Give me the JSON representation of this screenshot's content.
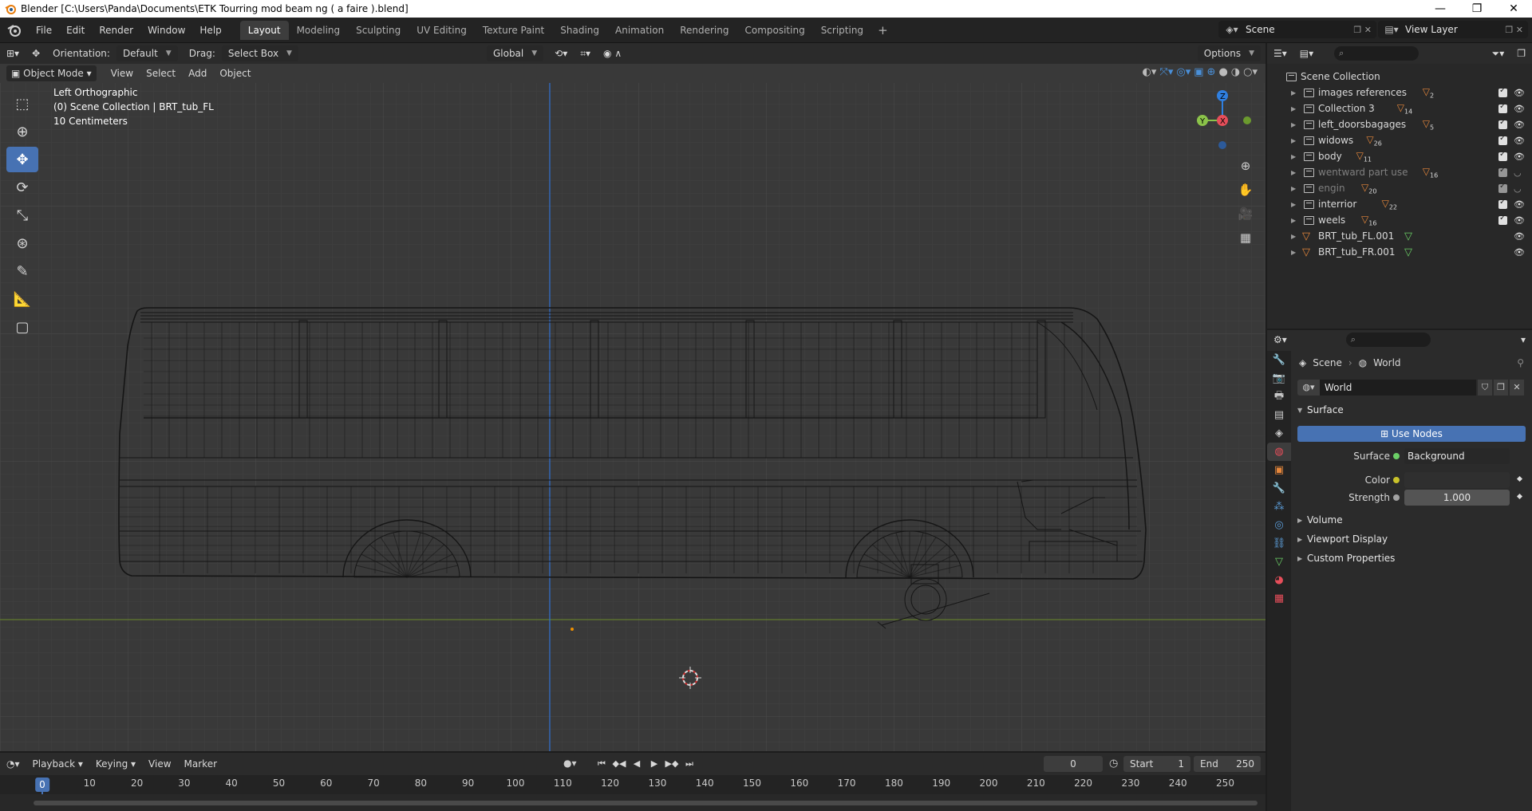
{
  "window": {
    "title": "Blender [C:\\Users\\Panda\\Documents\\ETK Tourring mod beam ng ( a faire ).blend]",
    "controls": [
      "—",
      "❐",
      "✕"
    ]
  },
  "menu": [
    "File",
    "Edit",
    "Render",
    "Window",
    "Help"
  ],
  "workspaces": [
    {
      "label": "Layout",
      "active": true
    },
    {
      "label": "Modeling"
    },
    {
      "label": "Sculpting"
    },
    {
      "label": "UV Editing"
    },
    {
      "label": "Texture Paint"
    },
    {
      "label": "Shading"
    },
    {
      "label": "Animation"
    },
    {
      "label": "Rendering"
    },
    {
      "label": "Compositing"
    },
    {
      "label": "Scripting"
    }
  ],
  "scene_selector": {
    "label": "Scene"
  },
  "view_layer_selector": {
    "label": "View Layer"
  },
  "viewport": {
    "header": {
      "orientation_label": "Orientation:",
      "orientation_value": "Default",
      "drag_label": "Drag:",
      "drag_value": "Select Box",
      "transform_space": "Global",
      "options": "Options"
    },
    "header2": {
      "mode": "Object Mode",
      "menus": [
        "View",
        "Select",
        "Add",
        "Object"
      ]
    },
    "overlay_lines": [
      "Left Orthographic",
      "(0) Scene Collection | BRT_tub_FL",
      "10 Centimeters"
    ],
    "gizmo_axes": {
      "z": "Z",
      "y": "Y",
      "x": "X"
    }
  },
  "timeline": {
    "menus": [
      "Playback",
      "Keying",
      "View",
      "Marker"
    ],
    "current_frame": "0",
    "start_label": "Start",
    "start_value": "1",
    "end_label": "End",
    "end_value": "250",
    "ticks": [
      "0",
      "10",
      "20",
      "30",
      "40",
      "50",
      "60",
      "70",
      "80",
      "90",
      "100",
      "110",
      "120",
      "130",
      "140",
      "150",
      "160",
      "170",
      "180",
      "190",
      "200",
      "210",
      "220",
      "230",
      "240",
      "250"
    ]
  },
  "outliner": {
    "root": "Scene Collection",
    "items": [
      {
        "label": "images references",
        "type": "collection",
        "badge": "2",
        "dim": false,
        "checked": true
      },
      {
        "label": "Collection 3",
        "type": "collection",
        "badge": "14",
        "dim": false,
        "checked": true
      },
      {
        "label": "left_doorsbagages",
        "type": "collection",
        "badge": "5",
        "dim": false,
        "checked": true
      },
      {
        "label": "widows",
        "type": "collection",
        "badge": "26",
        "dim": false,
        "checked": true
      },
      {
        "label": "body",
        "type": "collection",
        "badge": "11",
        "dim": false,
        "checked": true
      },
      {
        "label": "wentward part use",
        "type": "collection",
        "badge": "16",
        "dim": true,
        "checked": true
      },
      {
        "label": "engin",
        "type": "collection",
        "badge": "20",
        "dim": true,
        "checked": true
      },
      {
        "label": "interrior",
        "type": "collection",
        "badge": "22",
        "dim": false,
        "checked": true
      },
      {
        "label": "weels",
        "type": "collection",
        "badge": "16",
        "dim": false,
        "checked": true
      },
      {
        "label": "BRT_tub_FL.001",
        "type": "object",
        "badge": "",
        "dim": false,
        "checked": false
      },
      {
        "label": "BRT_tub_FR.001",
        "type": "object",
        "badge": "",
        "dim": false,
        "checked": false
      }
    ]
  },
  "properties": {
    "breadcrumb_scene": "Scene",
    "breadcrumb_world": "World",
    "world_name": "World",
    "surface_panel": "Surface",
    "use_nodes": "Use Nodes",
    "surface_label": "Surface",
    "surface_value": "Background",
    "color_label": "Color",
    "strength_label": "Strength",
    "strength_value": "1.000",
    "collapsed_panels": [
      "Volume",
      "Viewport Display",
      "Custom Properties"
    ]
  },
  "colors": {
    "accent": "#4772b3",
    "axis_x": "#e64e5a",
    "axis_y": "#8bc34a",
    "axis_z": "#2f7fe0",
    "object_orange": "#e6873b",
    "mesh_green": "#6bcf66"
  }
}
